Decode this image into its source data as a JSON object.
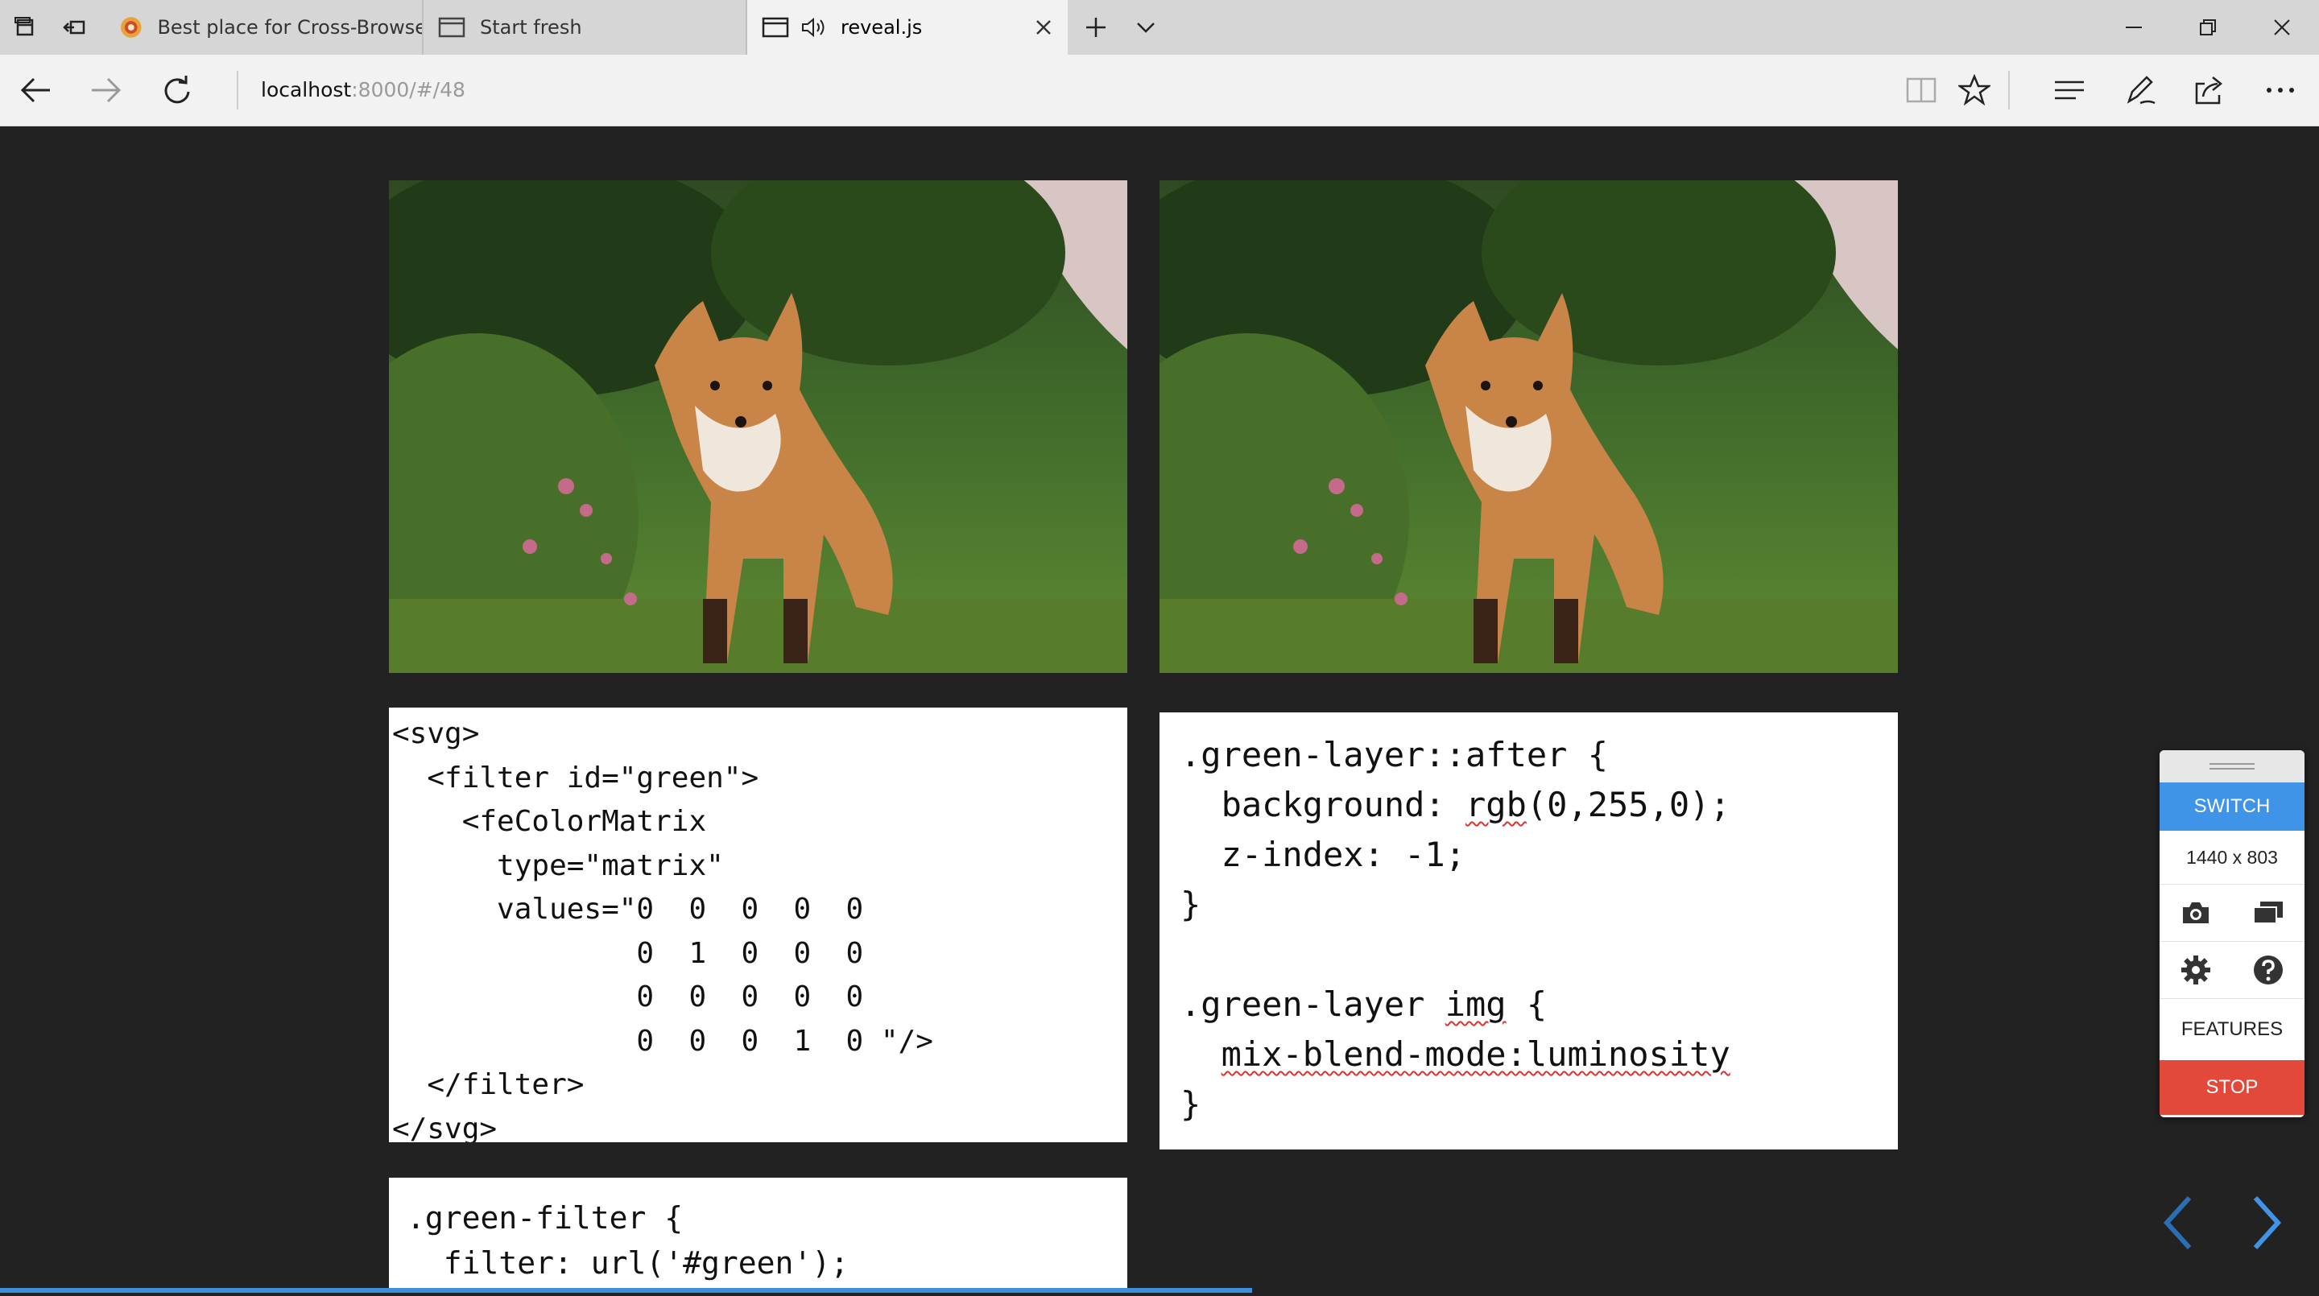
{
  "browser": {
    "tabs": [
      {
        "title": "Best place for Cross-Browse",
        "icon": "browser-favicon"
      },
      {
        "title": "Start fresh",
        "icon": "page-icon"
      },
      {
        "title": "reveal.js",
        "icon": "page-icon",
        "audio": "speaker-icon",
        "active": true
      }
    ],
    "url_host": "localhost",
    "url_path": ":8000/#/48"
  },
  "slide": {
    "code_svg": "<svg>\n  <filter id=\"green\">\n    <feColorMatrix\n      type=\"matrix\"\n      values=\"0  0  0  0  0\n              0  1  0  0  0\n              0  0  0  0  0\n              0  0  0  1  0 \"/>\n  </filter>\n</svg>",
    "code_css_line1": ".green-layer::after {",
    "code_css_line2_prop": "  background: ",
    "code_css_line2_fn": "rgb",
    "code_css_line2_rest": "(0,255,0);",
    "code_css_line3": "  z-index: -1;",
    "code_css_line4": "}",
    "code_css_line6_a": ".green-layer ",
    "code_css_line6_b": "img",
    "code_css_line6_c": " {",
    "code_css_line7": "mix-blend-mode:luminosity",
    "code_css_line8": "}",
    "code_filter": ".green-filter {\n  filter: url('#green');"
  },
  "panel": {
    "switch_label": "SWITCH",
    "resolution": "1440 x 803",
    "features_label": "FEATURES",
    "stop_label": "STOP"
  },
  "colors": {
    "accent": "#3f94e8",
    "stop": "#e2493b",
    "progress": "#3f8fdc",
    "background": "#222222"
  }
}
